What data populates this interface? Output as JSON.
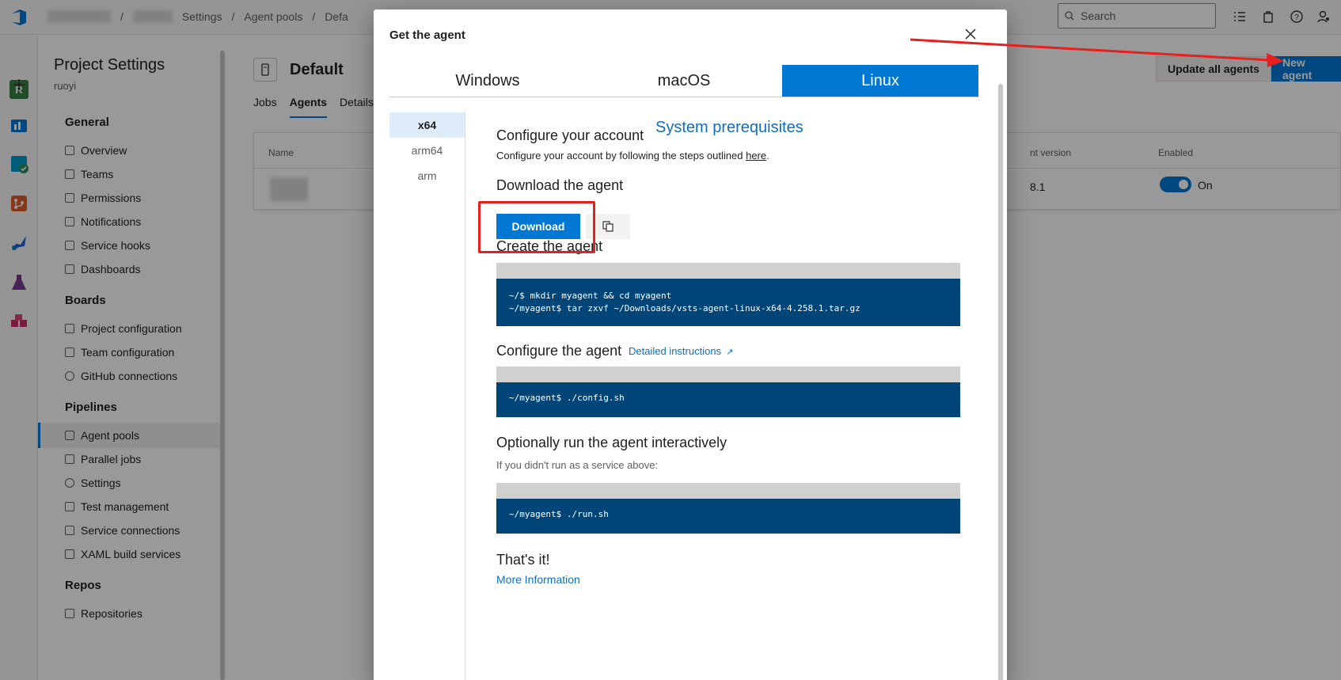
{
  "topbar": {
    "breadcrumb": [
      "Settings",
      "Agent pools",
      "Defa"
    ],
    "search_placeholder": "Search"
  },
  "rail": {
    "avatar": "R"
  },
  "settings": {
    "title": "Project Settings",
    "subtitle": "ruoyi",
    "groups": [
      {
        "label": "General",
        "items": [
          "Overview",
          "Teams",
          "Permissions",
          "Notifications",
          "Service hooks",
          "Dashboards"
        ]
      },
      {
        "label": "Boards",
        "items": [
          "Project configuration",
          "Team configuration",
          "GitHub connections"
        ]
      },
      {
        "label": "Pipelines",
        "items": [
          "Agent pools",
          "Parallel jobs",
          "Settings",
          "Test management",
          "Service connections",
          "XAML build services"
        ]
      },
      {
        "label": "Repos",
        "items": [
          "Repositories"
        ]
      }
    ]
  },
  "pool": {
    "title": "Default",
    "tabs": [
      "Jobs",
      "Agents",
      "Details"
    ],
    "update_btn": "Update all agents",
    "new_btn": "New agent",
    "columns": {
      "name": "Name",
      "version": "nt version",
      "enabled": "Enabled"
    },
    "row": {
      "version": "8.1",
      "enabled": "On"
    }
  },
  "dialog": {
    "title": "Get the agent",
    "os_tabs": [
      "Windows",
      "macOS",
      "Linux"
    ],
    "selected_os": "Linux",
    "arch": [
      "x64",
      "arm64",
      "arm"
    ],
    "selected_arch": "x64",
    "prereq": "System prerequisites",
    "configure_account": {
      "heading": "Configure your account",
      "text": "Configure your account by following the steps outlined ",
      "link": "here",
      "end": "."
    },
    "download": {
      "heading": "Download the agent",
      "button": "Download"
    },
    "create": {
      "heading": "Create the agent",
      "code": "~/$ mkdir myagent && cd myagent\n~/myagent$ tar zxvf ~/Downloads/vsts-agent-linux-x64-4.258.1.tar.gz"
    },
    "configure": {
      "heading": "Configure the agent",
      "link": "Detailed instructions",
      "code": "~/myagent$ ./config.sh"
    },
    "run": {
      "heading": "Optionally run the agent interactively",
      "note": "If you didn't run as a service above:",
      "code": "~/myagent$ ./run.sh"
    },
    "done": {
      "heading": "That's it!",
      "link": "More Information"
    }
  },
  "colors": {
    "accent": "#0078d4",
    "code_bg": "#004578",
    "annotation": "#e61f1f"
  }
}
